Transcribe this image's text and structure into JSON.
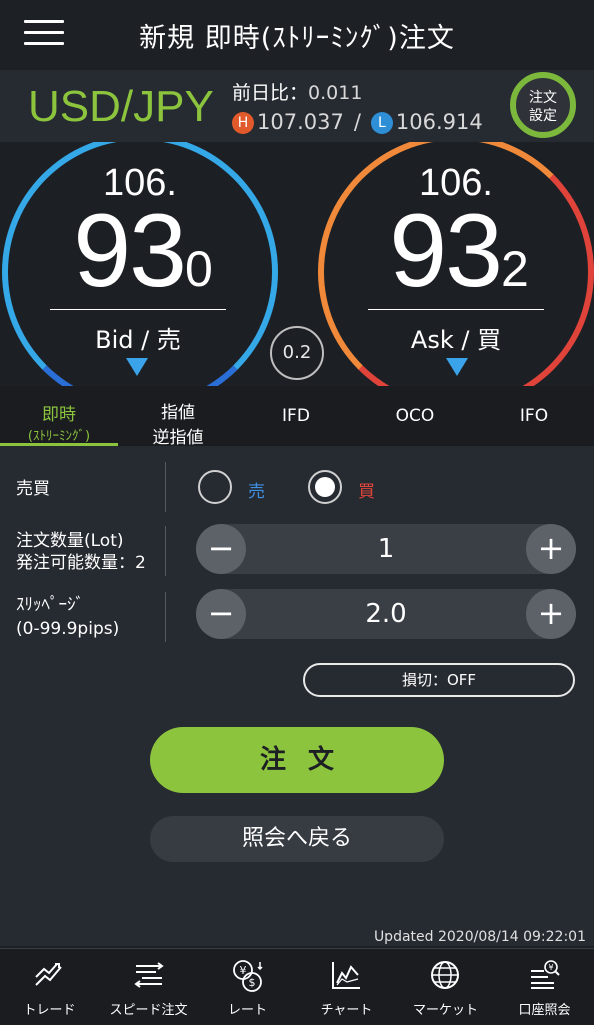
{
  "header": {
    "title": "新規 即時(ｽﾄﾘｰﾐﾝｸﾞ)注文"
  },
  "symbol": {
    "pair": "USD/JPY",
    "change_label": "前日比：",
    "change_value": "0.011",
    "high_badge": "H",
    "high": "107.037",
    "sep": "/",
    "low_badge": "L",
    "low": "106.914",
    "settings_line1": "注文",
    "settings_line2": "設定"
  },
  "rates": {
    "bid": {
      "prefix": "106.",
      "main": "93",
      "pip": "0",
      "label": "Bid / 売"
    },
    "ask": {
      "prefix": "106.",
      "main": "93",
      "pip": "2",
      "label": "Ask / 買"
    },
    "spread": "0.2"
  },
  "tabs": [
    {
      "line1": "即時",
      "line2": "(ｽﾄﾘｰﾐﾝｸﾞ)"
    },
    {
      "line1": "指値",
      "line2": "逆指値"
    },
    {
      "line1": "IFD",
      "line2": ""
    },
    {
      "line1": "OCO",
      "line2": ""
    },
    {
      "line1": "IFO",
      "line2": ""
    }
  ],
  "form": {
    "side_label": "売買",
    "sell_label": "売",
    "buy_label": "買",
    "selected_side": "buy",
    "qty_label": "注文数量(Lot)",
    "qty_available": "発注可能数量：2",
    "qty_value": "1",
    "slip_label": "ｽﾘｯﾍﾟｰｼﾞ",
    "slip_range": "(0-99.9pips)",
    "slip_value": "2.0",
    "stoploss": "損切：OFF",
    "order_button": "注文",
    "back_button": "照会へ戻る",
    "updated": "Updated  2020/08/14 09:22:01"
  },
  "nav": [
    {
      "label": "トレード",
      "icon": "trade-icon"
    },
    {
      "label": "スピード注文",
      "icon": "speed-order-icon"
    },
    {
      "label": "レート",
      "icon": "rate-icon"
    },
    {
      "label": "チャート",
      "icon": "chart-icon"
    },
    {
      "label": "マーケット",
      "icon": "globe-icon"
    },
    {
      "label": "口座照会",
      "icon": "account-icon"
    }
  ],
  "colors": {
    "accent": "#8cc43e",
    "bid": "#35a8e8",
    "ask": "#f08a3a",
    "sell_text": "#3f8fe0",
    "buy_text": "#e0453a"
  }
}
